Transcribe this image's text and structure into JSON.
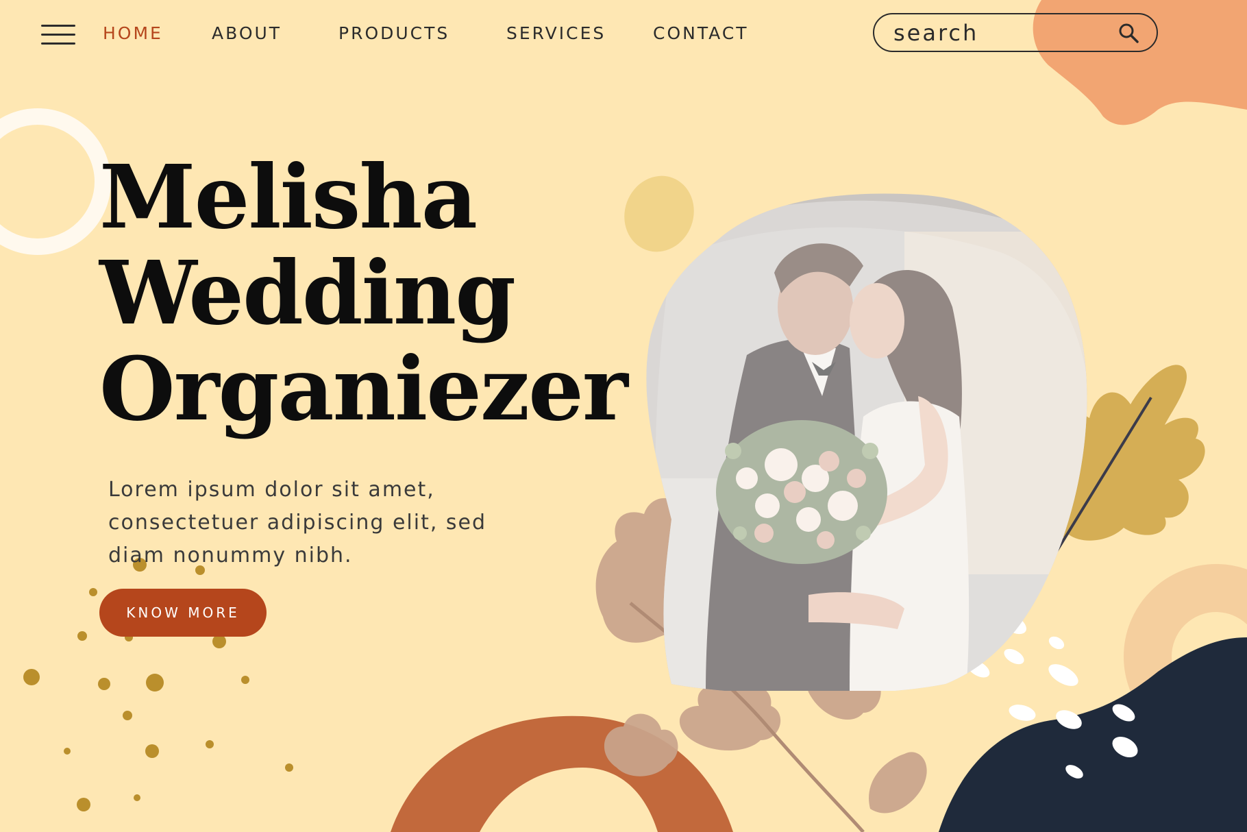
{
  "nav": {
    "menu_icon": "hamburger-menu-icon",
    "links": [
      {
        "label": "HOME",
        "active": true
      },
      {
        "label": "ABOUT",
        "active": false
      },
      {
        "label": "PRODUCTS",
        "active": false
      },
      {
        "label": "SERVICES",
        "active": false
      },
      {
        "label": "CONTACT",
        "active": false
      }
    ],
    "search": {
      "placeholder": "search",
      "icon": "search-icon"
    }
  },
  "hero": {
    "title_lines": [
      "Melisha",
      "Wedding",
      "Organiezer"
    ],
    "description": "Lorem ipsum dolor sit amet, consectetuer adipiscing elit, sed diam nonummy nibh.",
    "cta_label": "KNOW MORE",
    "image": "wedding-couple-under-veil-photo"
  },
  "colors": {
    "background": "#FEE7B3",
    "accent": "#B5461C",
    "text_dark": "#0D0D0D",
    "peach": "#F2A572",
    "gold": "#BA8F2C",
    "navy": "#1F2A3B",
    "rust": "#C2693C",
    "taupe": "#C9A48C",
    "mustard_leaf": "#D1A94D"
  }
}
